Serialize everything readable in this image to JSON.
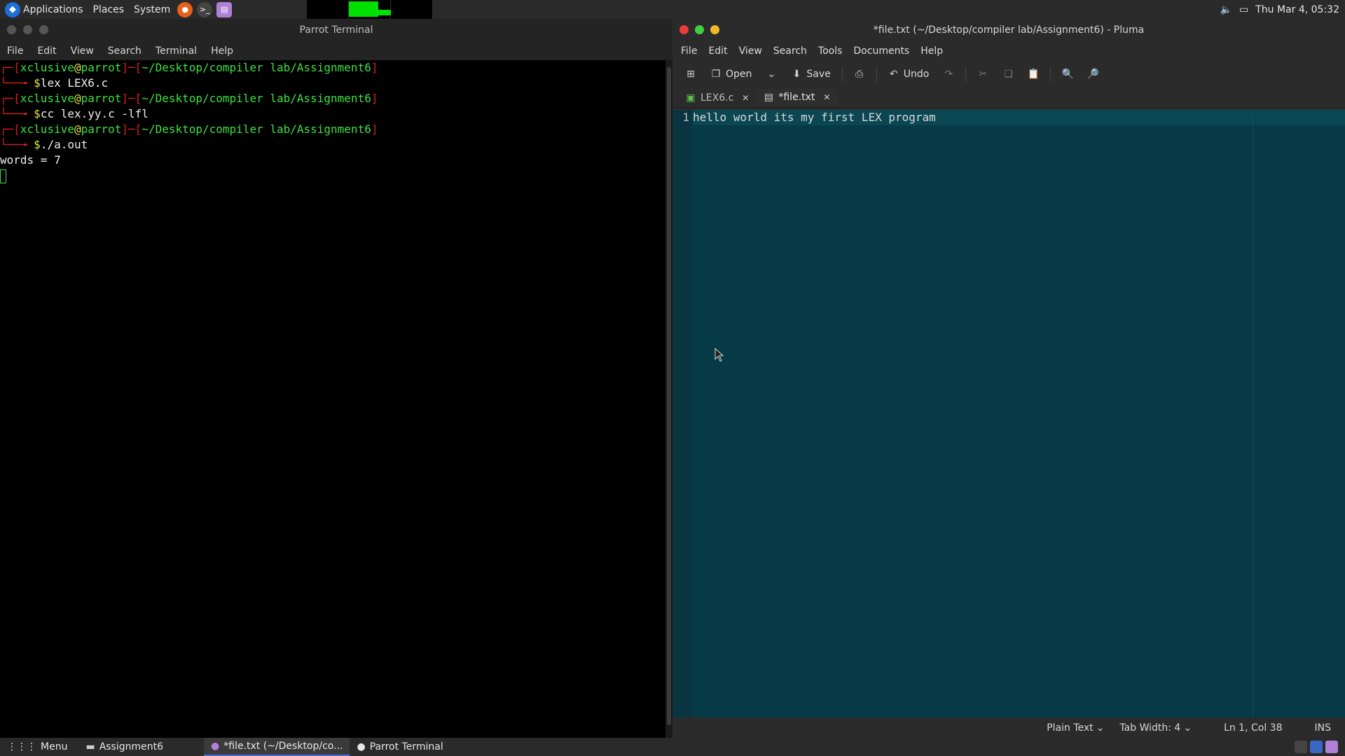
{
  "top_panel": {
    "applications": "Applications",
    "places": "Places",
    "system": "System",
    "clock": "Thu Mar  4, 05:32",
    "launchers": [
      "firefox-icon",
      "terminal-icon",
      "pluma-icon"
    ]
  },
  "terminal": {
    "title": "Parrot Terminal",
    "menu": [
      "File",
      "Edit",
      "View",
      "Search",
      "Terminal",
      "Help"
    ],
    "user": "xclusive",
    "host": "parrot",
    "path": "~/Desktop/compiler lab/Assignment6",
    "commands": [
      "lex LEX6.c",
      "cc lex.yy.c -lfl",
      "./a.out"
    ],
    "output": "words = 7"
  },
  "pluma": {
    "title": "*file.txt (~/Desktop/compiler lab/Assignment6) - Pluma",
    "menu": [
      "File",
      "Edit",
      "View",
      "Search",
      "Tools",
      "Documents",
      "Help"
    ],
    "toolbar": {
      "open": "Open",
      "save": "Save",
      "undo": "Undo"
    },
    "tabs": [
      {
        "label": "LEX6.c"
      },
      {
        "label": "*file.txt"
      }
    ],
    "line_number": "1",
    "content": "hello world its my first LEX program",
    "status": {
      "language": "Plain Text",
      "tab_width": "Tab Width:  4",
      "position": "Ln 1, Col 38",
      "mode": "INS"
    }
  },
  "bottom_panel": {
    "menu": "Menu",
    "tasks": [
      "Assignment6",
      "*file.txt (~/Desktop/co...",
      "Parrot Terminal"
    ]
  }
}
